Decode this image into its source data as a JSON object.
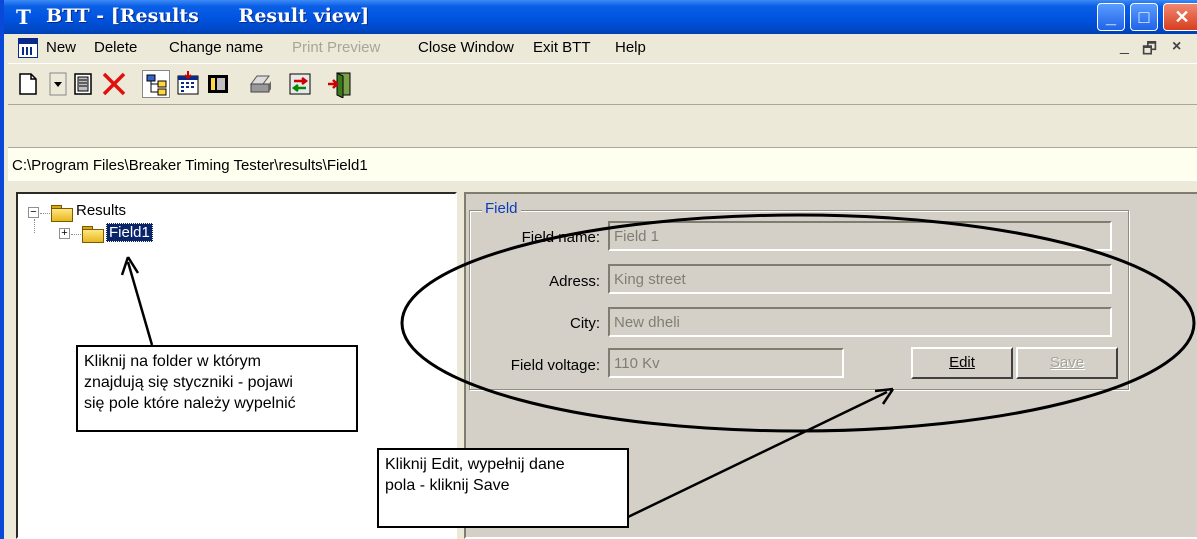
{
  "window": {
    "title": "BTT - [Results      Result view]",
    "app_icon_glyph": "T",
    "controls": {
      "minimize": "_",
      "maximize": "□",
      "close": "✕"
    }
  },
  "menu": {
    "items": [
      {
        "label": "New",
        "enabled": true
      },
      {
        "label": "Delete",
        "enabled": true
      },
      {
        "label": "Change name",
        "enabled": true
      },
      {
        "label": "Print Preview",
        "enabled": false
      },
      {
        "label": "Close Window",
        "enabled": true
      },
      {
        "label": "Exit BTT",
        "enabled": true
      },
      {
        "label": "Help",
        "enabled": true
      }
    ],
    "mdi_controls": {
      "minimize": "_",
      "restore": "🗗",
      "close": "×"
    }
  },
  "toolbar": {
    "icons": [
      "new-document-icon",
      "dropdown-arrow-icon",
      "properties-icon",
      "delete-icon",
      "tree-view-icon",
      "calendar-import-icon",
      "columns-icon",
      "printer-icon",
      "exchange-icon",
      "exit-door-icon"
    ]
  },
  "path": "C:\\Program Files\\Breaker Timing Tester\\results\\Field1",
  "tree": {
    "root": {
      "label": "Results",
      "expander": "−"
    },
    "child": {
      "label": "Field1",
      "expander": "+"
    }
  },
  "field_group": {
    "title": "Field",
    "fields": {
      "name": {
        "label": "Field name:",
        "value": "Field 1"
      },
      "address": {
        "label": "Adress:",
        "value": "King street"
      },
      "city": {
        "label": "City:",
        "value": "New dheli"
      },
      "voltage": {
        "label": "Field voltage:",
        "value": "110 Kv"
      }
    },
    "buttons": {
      "edit": {
        "label": "Edit",
        "enabled": true
      },
      "save": {
        "label": "Save",
        "enabled": false
      }
    }
  },
  "annotations": {
    "callout_1": "Kliknij na folder w którym\nznajdują się styczniki - pojawi\nsię pole które należy wypelnić",
    "callout_2": "Kliknij Edit, wypełnij dane\npola - kliknij Save"
  },
  "colors": {
    "titlebar": "#0053e0",
    "menubar": "#ece9d8",
    "pane": "#d4d0c8",
    "path_bar": "#fffff0",
    "tree_selection": "#0a246a",
    "group_title": "#0a3cbb"
  }
}
